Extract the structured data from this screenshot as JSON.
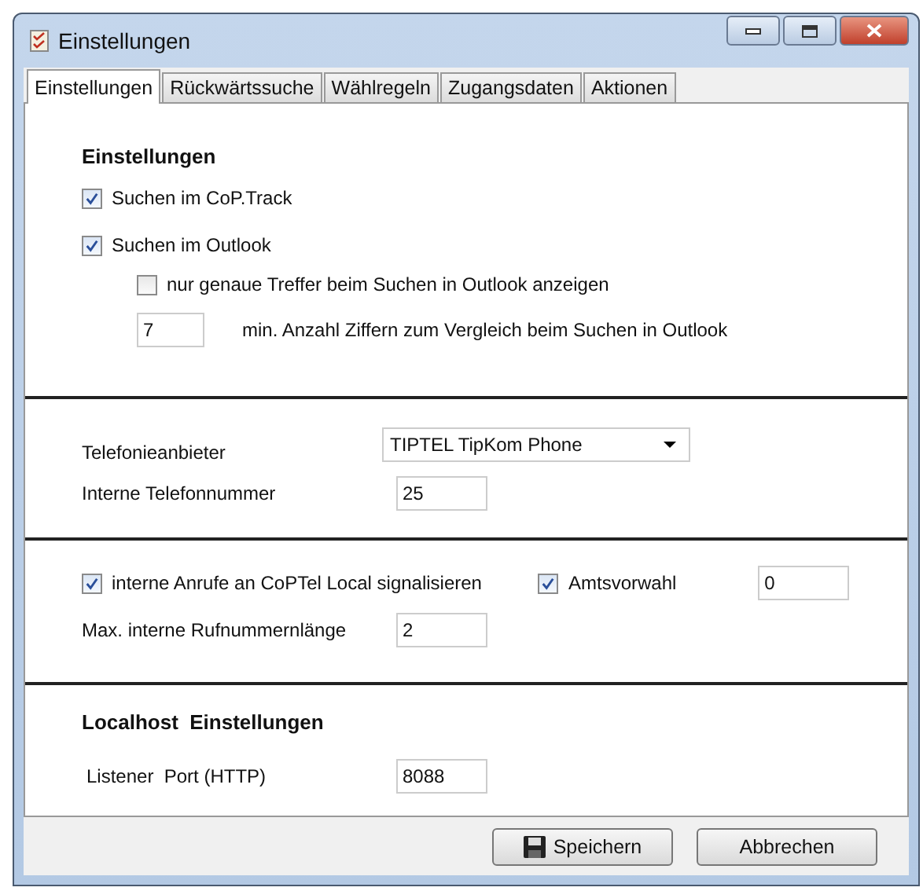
{
  "window": {
    "title": "Einstellungen"
  },
  "tabs": [
    {
      "label": "Einstellungen",
      "selected": true
    },
    {
      "label": "Rückwärtssuche",
      "selected": false
    },
    {
      "label": "Wählregeln",
      "selected": false
    },
    {
      "label": "Zugangsdaten",
      "selected": false
    },
    {
      "label": "Aktionen",
      "selected": false
    }
  ],
  "search_section": {
    "heading": "Einstellungen",
    "search_cop_track": {
      "label": "Suchen im CoP.Track",
      "checked": true
    },
    "search_outlook": {
      "label": "Suchen im Outlook",
      "checked": true
    },
    "exact_matches": {
      "label": "nur genaue Treffer beim Suchen in Outlook anzeigen",
      "checked": false
    },
    "min_digits": {
      "value": "7",
      "label": "min. Anzahl Ziffern zum Vergleich beim Suchen in Outlook"
    }
  },
  "telephony_section": {
    "provider": {
      "label": "Telefonieanbieter",
      "value": "TIPTEL TipKom Phone"
    },
    "internal_number": {
      "label": "Interne Telefonnummer",
      "value": "25"
    }
  },
  "signaling_section": {
    "signal_internal": {
      "label": "interne Anrufe an CoPTel Local signalisieren",
      "checked": true
    },
    "trunk_prefix": {
      "label": "Amtsvorwahl",
      "checked": true,
      "value": "0"
    },
    "max_length": {
      "label": "Max. interne Rufnummernlänge",
      "value": "2"
    }
  },
  "localhost_section": {
    "heading": "Localhost  Einstellungen",
    "listener_port": {
      "label": "Listener  Port (HTTP)",
      "value": "8088"
    }
  },
  "buttons": [
    {
      "label": "Speichern",
      "kind": "save"
    },
    {
      "label": "Abbrechen",
      "kind": "plain"
    }
  ]
}
